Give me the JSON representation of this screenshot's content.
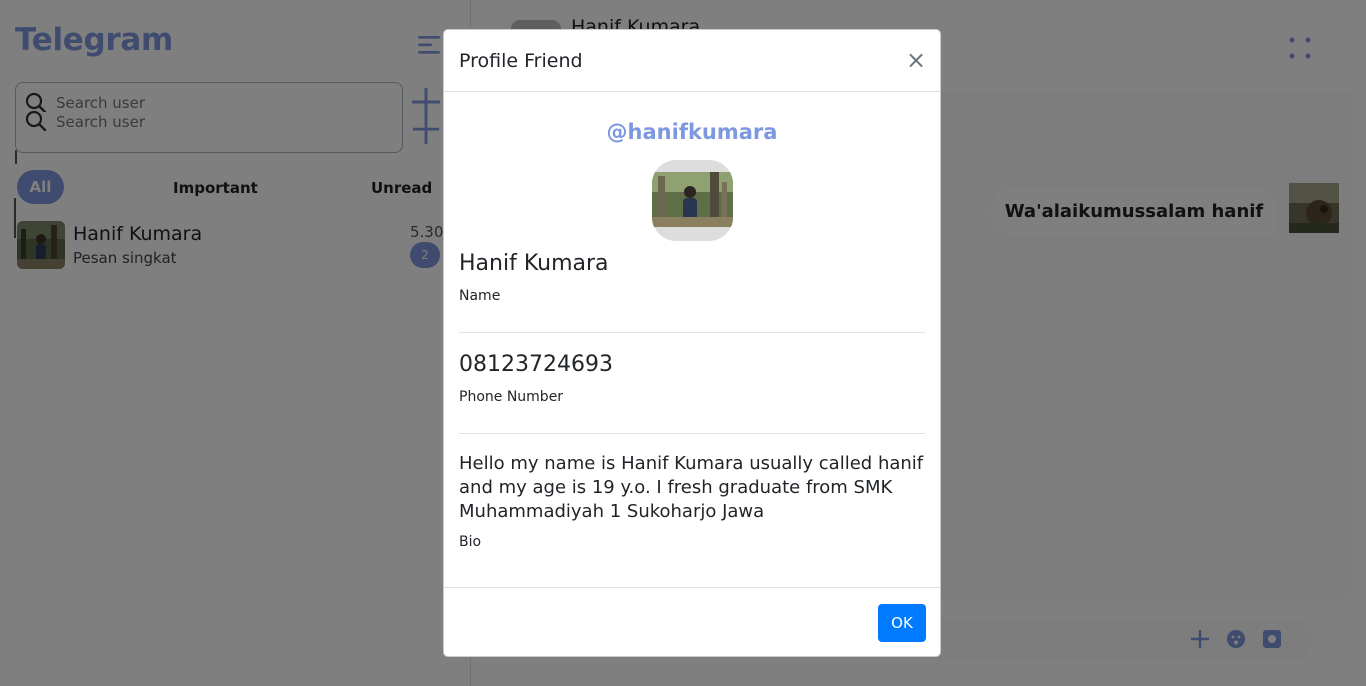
{
  "app": {
    "brand": "Telegram"
  },
  "search": {
    "placeholder": "Search user"
  },
  "filters": {
    "all": "All",
    "important": "Important",
    "unread": "Unread"
  },
  "chat_list": [
    {
      "name": "Hanif Kumara",
      "preview": "Pesan singkat",
      "time": "5.30",
      "unread_count": "2"
    }
  ],
  "room": {
    "header_name": "Hanif Kumara",
    "messages": [
      {
        "text": "Wa'alaikumussalam hanif"
      }
    ]
  },
  "modal": {
    "title": "Profile Friend",
    "close_glyph": "×",
    "username": "@hanifkumara",
    "name_value": "Hanif Kumara",
    "name_label": "Name",
    "phone_value": "08123724693",
    "phone_label": "Phone Number",
    "bio_value": "Hello my name is Hanif Kumara usually called hanif and my age is 19 y.o. I fresh graduate from SMK Muhammadiyah 1 Sukoharjo Jawa",
    "bio_label": "Bio",
    "ok_label": "OK"
  },
  "colors": {
    "brand": "#7e98df",
    "primary_button": "#007bff",
    "backdrop": "rgba(0,0,0,0.5)"
  },
  "icons": {
    "menu": "menu-lines-icon",
    "search": "magnifier-icon",
    "add": "plus-icon",
    "more": "dots-grid-icon",
    "emoji": "emoji-icon",
    "camera": "camera-icon",
    "close": "close-icon"
  }
}
